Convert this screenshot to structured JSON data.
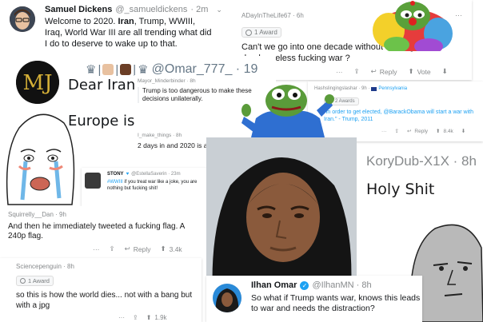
{
  "tweet_samuel": {
    "name": "Samuel Dickens",
    "handle": "@_samueldickens",
    "time": "· 2m",
    "text_pre": "Welcome to 2020. ",
    "text_bold1": "Iran",
    "text_mid": ", Trump, WWIII,",
    "text_line2": "Iraq, World War III are all trending what did",
    "text_line3": "I do to deserve to wake up to that."
  },
  "reddit_adayinthelife": {
    "user": "ADayInTheLife67 · 6h",
    "award": "1 Award",
    "text": "Can't we go into one decade without starting a dumb useless fucking war ?",
    "reply": "Reply",
    "vote": "Vote"
  },
  "tweet_omar777": {
    "handle": "@Omar_777_ · 19",
    "line1": "Dear Iran",
    "line2": "Europe is with you ..",
    "line3": "2 days in and 2020 is already a shitsh"
  },
  "reddit_mayor": {
    "user": "Mayor_Minderbinder · 8h",
    "text": "Trump is too dangerous to make these decisions unilaterally.",
    "user2": "I_make_things · 8h"
  },
  "reddit_hashslinging": {
    "user": "Hashslingingslashar · 9h · ",
    "flair": "Pennsylvania",
    "award": "2 Awards",
    "text": "\"In order to get elected, @BarackObama will start a war with Iran.\" - Trump, 2011",
    "reply": "Reply",
    "votes": "8.4k"
  },
  "reddit_korydub": {
    "user": "KoryDub-X1X · 8h",
    "text": "Holy Shit"
  },
  "tweet_stony": {
    "name": "STONY",
    "handle": "@EstellaSaverin · 23m",
    "hashtag": "#WWIII",
    "text": " if you treat war like a joke,  you are nothing but fucking shit!"
  },
  "reddit_squirrelly": {
    "user": "Squirrelly__Dan · 9h",
    "text": "And then he immediately tweeted a fucking flag.  A 240p flag.",
    "reply": "Reply",
    "votes": "3.4k"
  },
  "reddit_sciencepenguin": {
    "user": "Sciencepenguin · 8h",
    "award": "1 Award",
    "text": "so this is how the world dies... not with a bang but with a jpg",
    "votes": "1.9k"
  },
  "tweet_ilhan": {
    "name": "Ilhan Omar",
    "handle": "@IlhanMN · 8h",
    "text": "So what if Trump wants war, knows this leads to war and needs the distraction?"
  },
  "icons": [
    "share-icon",
    "upvote-icon",
    "downvote-icon",
    "award-icon",
    "more-icon",
    "verified-icon",
    "chevron-down-icon"
  ],
  "colors": {
    "twitter_blue": "#1da1f2",
    "reddit_gray": "#878a8c",
    "pepe_green": "#5a9b3a",
    "meme_brown": "#8a4b2e"
  }
}
